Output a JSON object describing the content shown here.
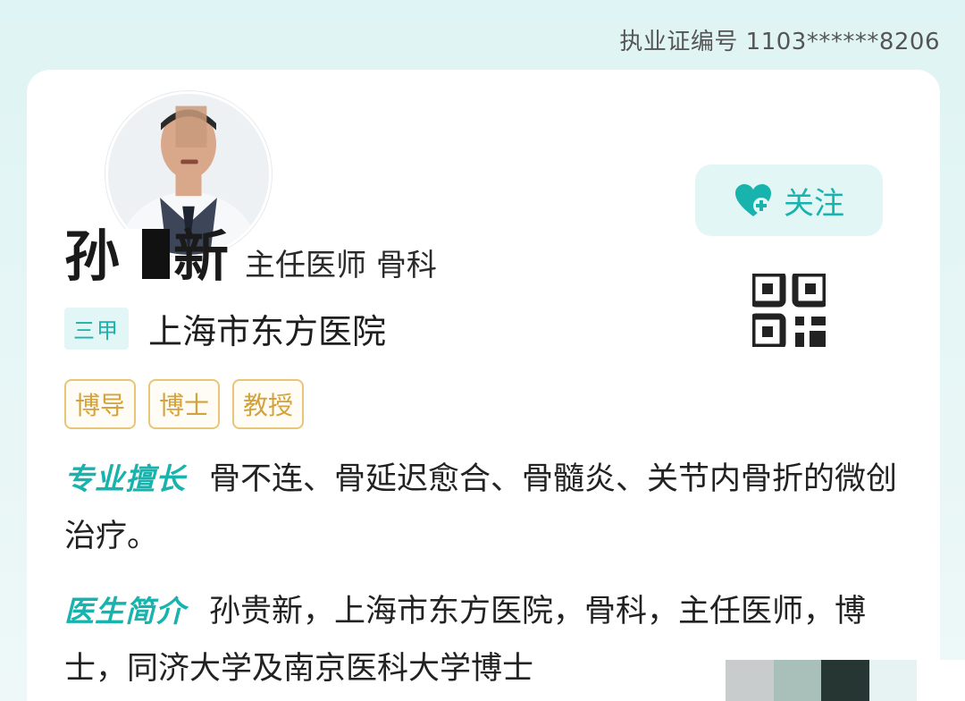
{
  "license": {
    "text": "执业证编号 1103******8206"
  },
  "doctor": {
    "name_first": "孙",
    "name_last": "新",
    "title_dept": "主任医师  骨科"
  },
  "follow": {
    "label": "关注",
    "icon": "heart-plus-icon",
    "accent": "#19b3ad"
  },
  "hospital": {
    "grade": "三甲",
    "name": "上海市东方医院"
  },
  "tags": [
    "博导",
    "博士",
    "教授"
  ],
  "specialty": {
    "heading": "专业擅长",
    "text": "骨不连、骨延迟愈合、骨髓炎、关节内骨折的微创治疗。"
  },
  "intro": {
    "heading": "医生简介",
    "text": "孙贵新，上海市东方医院，骨科，主任医师，博士，同济大学及南京医科大学博士"
  },
  "colors": {
    "accent": "#19b3ad",
    "tag": "#d4a23a",
    "background": "#e8f6f6"
  }
}
